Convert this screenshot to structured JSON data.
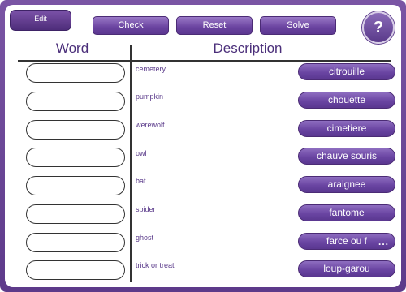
{
  "toolbar": {
    "edit_label": "Edit",
    "check_label": "Check",
    "reset_label": "Reset",
    "solve_label": "Solve",
    "help_label": "?"
  },
  "columns": {
    "word": "Word",
    "description": "Description"
  },
  "descriptions": [
    "cemetery",
    "pumpkin",
    "werewolf",
    "owl",
    "bat",
    "spider",
    "ghost",
    "trick or treat"
  ],
  "answers": [
    "citrouille",
    "chouette",
    "cimetiere",
    "chauve souris",
    "araignee",
    "fantome",
    "farce ou f",
    "loup-garou"
  ],
  "truncated_indicator": "...",
  "colors": {
    "accent": "#6a45a2",
    "frame": "#5d3a8a",
    "text_purple": "#4b2f7a"
  },
  "icons": {
    "help": "question-mark-icon"
  }
}
